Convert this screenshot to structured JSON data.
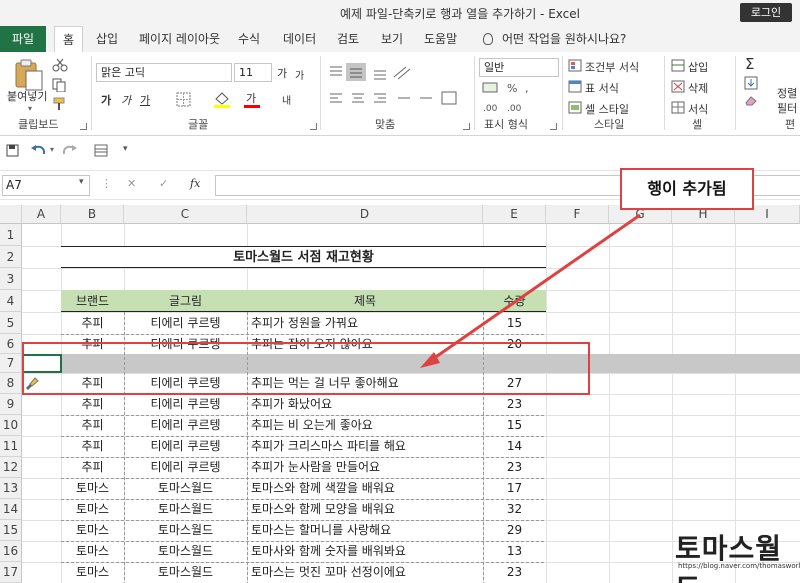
{
  "window": {
    "title": "예제 파일-단축키로 행과 열을 추가하기  -  Excel",
    "login": "로그인"
  },
  "tabs": [
    "파일",
    "홈",
    "삽입",
    "페이지 레이아웃",
    "수식",
    "데이터",
    "검토",
    "보기",
    "도움말"
  ],
  "tell_me": "어떤 작업을 원하시나요?",
  "ribbon": {
    "clipboard": {
      "paste": "붙여넣기",
      "label": "클립보드"
    },
    "font": {
      "name": "맑은 고딕",
      "size": "11",
      "grow": "가",
      "shrink": "가",
      "bold": "가",
      "italic": "가",
      "underline": "가",
      "font_color": "가",
      "phonetic": "내",
      "label": "글꼴"
    },
    "align": {
      "label": "맞춤"
    },
    "number": {
      "format": "일반",
      "label": "표시 형식"
    },
    "styles": {
      "cond": "조건부 서식",
      "table": "표 서식",
      "cell": "셀 스타일",
      "label": "스타일"
    },
    "cells": {
      "insert": "삽입",
      "delete": "삭제",
      "format": "서식",
      "label": "셀"
    },
    "editing": {
      "sum": "Σ",
      "sort": "정렬",
      "filter": "필터",
      "label": "편"
    }
  },
  "formula_bar": {
    "name_box": "A7",
    "fx": "fx",
    "value": ""
  },
  "columns": [
    "A",
    "B",
    "C",
    "D",
    "E",
    "F",
    "G",
    "H",
    "I"
  ],
  "rows": [
    "1",
    "2",
    "3",
    "4",
    "5",
    "6",
    "7",
    "8",
    "9",
    "10",
    "11",
    "12",
    "13",
    "14",
    "15",
    "16",
    "17"
  ],
  "sheet": {
    "title": "토마스월드 서점 재고현황",
    "headers": [
      "브랜드",
      "글그림",
      "제목",
      "수량"
    ],
    "data": [
      {
        "row": "5",
        "brand": "추피",
        "author": "티에리 쿠르텡",
        "title": "추피가 정원을 가꿔요",
        "qty": "15"
      },
      {
        "row": "6",
        "brand": "추피",
        "author": "티에리 쿠르텡",
        "title": "추피는 잠이 오지 않아요",
        "qty": "20"
      },
      {
        "row": "8",
        "brand": "추피",
        "author": "티에리 쿠르텡",
        "title": "추피는 먹는 걸 너무 좋아해요",
        "qty": "27"
      },
      {
        "row": "9",
        "brand": "추피",
        "author": "티에리 쿠르텡",
        "title": "추피가 화났어요",
        "qty": "23"
      },
      {
        "row": "10",
        "brand": "추피",
        "author": "티에리 쿠르텡",
        "title": "추피는 비 오는게 좋아요",
        "qty": "15"
      },
      {
        "row": "11",
        "brand": "추피",
        "author": "티에리 쿠르텡",
        "title": "추피가 크리스마스 파티를 해요",
        "qty": "14"
      },
      {
        "row": "12",
        "brand": "추피",
        "author": "티에리 쿠르텡",
        "title": "추피가 눈사람을 만들어요",
        "qty": "23"
      },
      {
        "row": "13",
        "brand": "토마스",
        "author": "토마스월드",
        "title": "토마스와 함께 색깔을 배워요",
        "qty": "17"
      },
      {
        "row": "14",
        "brand": "토마스",
        "author": "토마스월드",
        "title": "토마스와 함께 모양을 배워요",
        "qty": "32"
      },
      {
        "row": "15",
        "brand": "토마스",
        "author": "토마스월드",
        "title": "토마스는 할머니를 사랑해요",
        "qty": "29"
      },
      {
        "row": "16",
        "brand": "토마스",
        "author": "토마스월드",
        "title": "토마사와 함께 숫자를 배워봐요",
        "qty": "13"
      },
      {
        "row": "17",
        "brand": "토마스",
        "author": "토마스월드",
        "title": "토마스는 멋진 꼬마 선정이에요",
        "qty": "23"
      }
    ]
  },
  "annotation": {
    "callout": "행이 추가됨"
  },
  "watermark": {
    "text": "토마스월드",
    "url": "https://blog.naver.com/thomasworld"
  },
  "colors": {
    "excel_green": "#217346",
    "header_fill": "#c6e0b4",
    "selected_row": "#c8c8c8",
    "annotation_red": "#e0403f"
  }
}
